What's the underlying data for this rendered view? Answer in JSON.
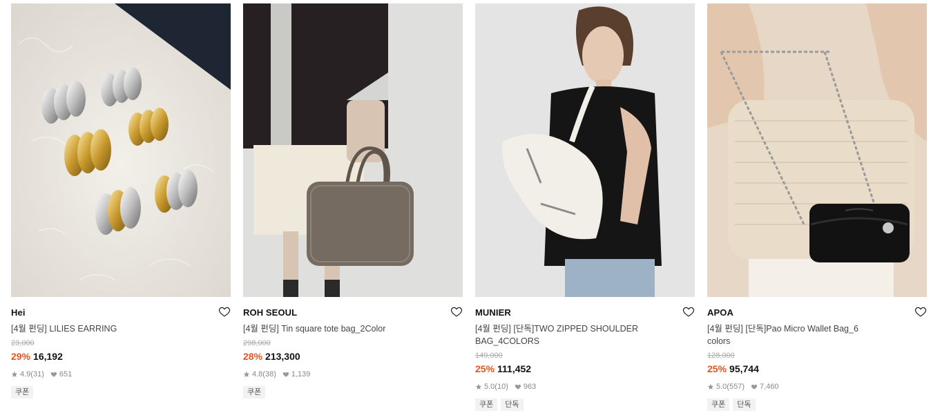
{
  "products": [
    {
      "brand": "Hei",
      "title": "[4월 펀딩] LILIES EARRING",
      "original_price": "23,000",
      "discount": "29%",
      "price": "16,192",
      "rating": "4.9",
      "reviews": "(31)",
      "likes": "651",
      "tags": [
        "쿠폰"
      ]
    },
    {
      "brand": "ROH SEOUL",
      "title": "[4월 펀딩] Tin square tote bag_2Color",
      "original_price": "298,000",
      "discount": "28%",
      "price": "213,300",
      "rating": "4.8",
      "reviews": "(38)",
      "likes": "1,139",
      "tags": [
        "쿠폰"
      ]
    },
    {
      "brand": "MUNIER",
      "title": "[4월 펀딩] [단독]TWO ZIPPED SHOULDER BAG_4COLORS",
      "original_price": "149,000",
      "discount": "25%",
      "price": "111,452",
      "rating": "5.0",
      "reviews": "(10)",
      "likes": "963",
      "tags": [
        "쿠폰",
        "단독"
      ]
    },
    {
      "brand": "APOA",
      "title": "[4월 펀딩] [단독]Pao Micro Wallet Bag_6 colors",
      "original_price": "128,000",
      "discount": "25%",
      "price": "95,744",
      "rating": "5.0",
      "reviews": "(557)",
      "likes": "7,460",
      "tags": [
        "쿠폰",
        "단독"
      ]
    }
  ],
  "colors": {
    "discount": "#e8541f",
    "muted": "#888888",
    "tag_bg": "#f2f2f2"
  }
}
